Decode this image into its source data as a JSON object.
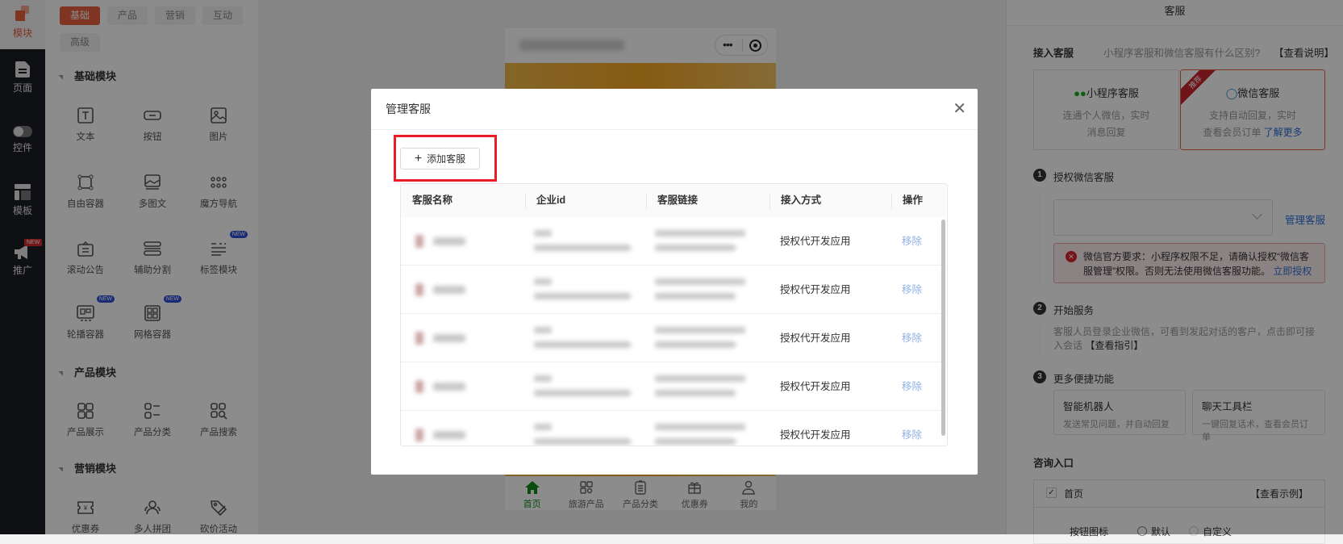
{
  "nav": {
    "items": [
      {
        "label": "模块",
        "icon": "modules-icon"
      },
      {
        "label": "页面",
        "icon": "page-icon"
      },
      {
        "label": "控件",
        "icon": "toggle-icon"
      },
      {
        "label": "模板",
        "icon": "template-icon"
      },
      {
        "label": "推广",
        "icon": "megaphone-icon",
        "badge": "NEW"
      }
    ]
  },
  "left_panel": {
    "tabs": [
      "基础",
      "产品",
      "营销",
      "互动",
      "高级"
    ],
    "sections": [
      {
        "title": "基础模块",
        "items": [
          {
            "label": "文本",
            "icon": "text"
          },
          {
            "label": "按钮",
            "icon": "button"
          },
          {
            "label": "图片",
            "icon": "image"
          },
          {
            "label": "自由容器",
            "icon": "free"
          },
          {
            "label": "多图文",
            "icon": "multi"
          },
          {
            "label": "魔方导航",
            "icon": "dots"
          },
          {
            "label": "滚动公告",
            "icon": "notice"
          },
          {
            "label": "辅助分割",
            "icon": "divider"
          },
          {
            "label": "标签模块",
            "icon": "tags",
            "badge": "NEW"
          },
          {
            "label": "轮播容器",
            "icon": "carousel",
            "badge": "NEW"
          },
          {
            "label": "网格容器",
            "icon": "grid",
            "badge": "NEW"
          }
        ]
      },
      {
        "title": "产品模块",
        "items": [
          {
            "label": "产品展示",
            "icon": "grid4"
          },
          {
            "label": "产品分类",
            "icon": "list"
          },
          {
            "label": "产品搜索",
            "icon": "search"
          }
        ]
      },
      {
        "title": "营销模块",
        "items": [
          {
            "label": "优惠券",
            "icon": "coupon"
          },
          {
            "label": "多人拼团",
            "icon": "group"
          },
          {
            "label": "砍价活动",
            "icon": "tag"
          }
        ]
      }
    ]
  },
  "phone": {
    "tabs": [
      {
        "label": "首页",
        "icon": "home",
        "active": true
      },
      {
        "label": "旅游产品",
        "icon": "grid"
      },
      {
        "label": "产品分类",
        "icon": "clipboard"
      },
      {
        "label": "优惠券",
        "icon": "gift"
      },
      {
        "label": "我的",
        "icon": "user"
      }
    ]
  },
  "right_panel": {
    "title": "客服",
    "connect_label": "接入客服",
    "connect_help": "小程序客服和微信客服有什么区别?",
    "connect_help_link": "【查看说明】",
    "options": [
      {
        "title": "小程序客服",
        "desc1": "连通个人微信，实时",
        "desc2": "消息回复"
      },
      {
        "title": "微信客服",
        "desc1": "支持自动回复，实时",
        "desc2": "查看会员订单",
        "link": "了解更多",
        "ribbon": "推荐"
      }
    ],
    "step1": {
      "num": "1",
      "title": "授权微信客服",
      "select_value": "",
      "manage_link": "管理客服",
      "error": "微信官方要求：小程序权限不足，请确认授权“微信客服管理”权限。否则无法使用微信客服功能。",
      "error_link": "立即授权"
    },
    "step2": {
      "num": "2",
      "title": "开始服务",
      "desc": "客服人员登录企业微信，可看到发起对话的客户，点击即可接入会话",
      "link": "【查看指引】"
    },
    "step3": {
      "num": "3",
      "title": "更多便捷功能",
      "cards": [
        {
          "title": "智能机器人",
          "desc": "发送常见问题，并自动回复"
        },
        {
          "title": "聊天工具栏",
          "desc": "一键回复话术，查看会员订单"
        }
      ]
    },
    "entry": {
      "title": "咨询入口",
      "page": "首页",
      "example_link": "【查看示例】",
      "icon_label": "按钮图标",
      "radio_default": "默认",
      "radio_custom": "自定义"
    }
  },
  "modal": {
    "title": "管理客服",
    "add_button": "添加客服",
    "columns": [
      "客服名称",
      "企业id",
      "客服链接",
      "接入方式",
      "操作"
    ],
    "rows": [
      {
        "method": "授权代开发应用",
        "action": "移除"
      },
      {
        "method": "授权代开发应用",
        "action": "移除"
      },
      {
        "method": "授权代开发应用",
        "action": "移除"
      },
      {
        "method": "授权代开发应用",
        "action": "移除"
      },
      {
        "method": "授权代开发应用",
        "action": "移除"
      }
    ]
  },
  "colors": {
    "brand": "#e8613c",
    "link": "#2f6fd8",
    "remove": "#8fb0e3",
    "error_bg": "#fdeeee",
    "error_border": "#f1a7a7",
    "active_tab": "#138a17"
  }
}
